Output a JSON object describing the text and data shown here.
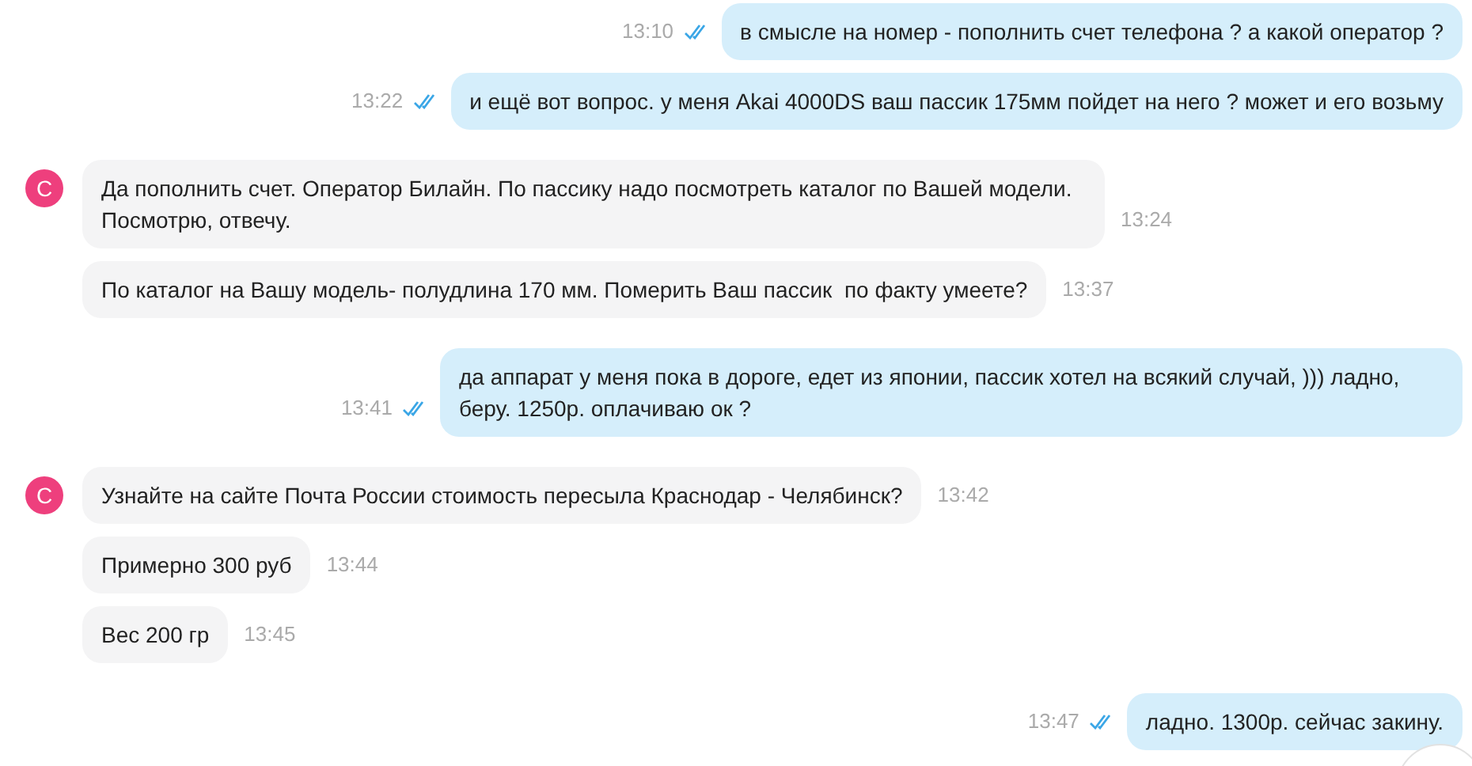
{
  "messages": [
    {
      "kind": "sent",
      "text": "в смысле на номер - пополнить счет телефона ? а какой оператор ?",
      "time": "13:10",
      "read": true
    },
    {
      "kind": "sent",
      "text": "и ещё вот вопрос. у меня Akai 4000DS ваш пассик 175мм пойдет на него ? может и его возьму",
      "time": "13:22",
      "read": true
    },
    {
      "kind": "received",
      "avatar": "С",
      "text": "Да пополнить счет. Оператор Билайн. По пассику надо посмотреть каталог по Вашей модели. Посмотрю, отвечу.",
      "time": "13:24"
    },
    {
      "kind": "received",
      "text": "По каталог на Вашу модель- полудлина 170 мм. Померить Ваш пассик  по факту умеете?",
      "time": "13:37"
    },
    {
      "kind": "sent",
      "text": "да аппарат у меня пока в дороге, едет из японии, пассик хотел на всякий случай, ))) ладно, беру. 1250р. оплачиваю ок ?",
      "time": "13:41",
      "read": true
    },
    {
      "kind": "received",
      "avatar": "С",
      "text": "Узнайте на сайте Почта России стоимость пересыла Краснодар - Челябинск?",
      "time": "13:42"
    },
    {
      "kind": "received",
      "text": "Примерно 300 руб",
      "time": "13:44"
    },
    {
      "kind": "received",
      "text": "Вес 200 гр",
      "time": "13:45"
    },
    {
      "kind": "sent",
      "text": "ладно. 1300р. сейчас закину.",
      "time": "13:47",
      "read": true
    }
  ]
}
